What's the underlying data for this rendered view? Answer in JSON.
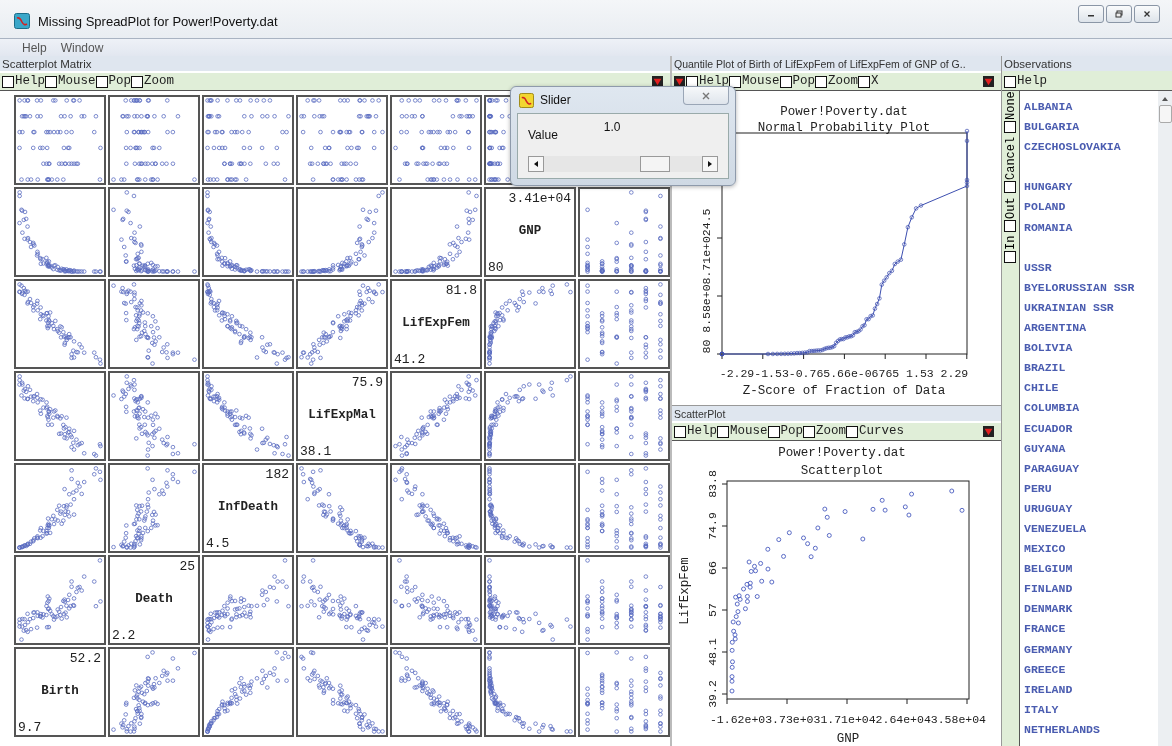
{
  "window": {
    "title": "Missing SpreadPlot for Power!Poverty.dat"
  },
  "menu": [
    "Help",
    "Window"
  ],
  "scatterplot_matrix": {
    "title": "Scatterplot Matrix",
    "toolbar": [
      {
        "label": "Help",
        "checked": false
      },
      {
        "label": "Mouse",
        "checked": false
      },
      {
        "label": "Pop",
        "checked": false
      },
      {
        "label": "Zoom",
        "checked": false
      }
    ],
    "variables": [
      {
        "name": "Birth",
        "max": "52.2",
        "min": "9.7"
      },
      {
        "name": "Death",
        "max": "25",
        "min": "2.2"
      },
      {
        "name": "InfDeath",
        "max": "182",
        "min": "4.5"
      },
      {
        "name": "LifExpMal",
        "max": "75.9",
        "min": "38.1"
      },
      {
        "name": "LifExpFem",
        "max": "81.8",
        "min": "41.2"
      },
      {
        "name": "GNP",
        "max": "3.41e+04",
        "min": "80"
      }
    ]
  },
  "quantile_plot": {
    "title": "Quantile Plot of Birth of LifExpFem of LifExpFem of GNP of G..",
    "toolbar": [
      {
        "label": "Help",
        "checked": false
      },
      {
        "label": "Mouse",
        "checked": false
      },
      {
        "label": "Pop",
        "checked": false
      },
      {
        "label": "Zoom",
        "checked": false
      },
      {
        "label": "X",
        "checked": false
      }
    ],
    "plot_title": "Power!Poverty.dat",
    "plot_subtitle": "Normal Probability Plot",
    "y_tick_labels": "80  8.58e+08.71e+024.5",
    "x_tick_labels": "-2.29-1.53-0.765.66e-06765 1.53 2.29",
    "xlabel": "Z-Score of Fraction of Data"
  },
  "scatterplot": {
    "title": "ScatterPlot",
    "toolbar": [
      {
        "label": "Help",
        "checked": false
      },
      {
        "label": "Mouse",
        "checked": false
      },
      {
        "label": "Pop",
        "checked": false
      },
      {
        "label": "Zoom",
        "checked": false
      },
      {
        "label": "Curves",
        "checked": false
      }
    ],
    "plot_title": "Power!Poverty.dat",
    "plot_subtitle": "Scatterplot",
    "ylabel": "LifExpFem",
    "yticks": [
      "39.2",
      "48.1",
      "57",
      "66",
      "74.9",
      "83.8"
    ],
    "x_tick_labels": "-1.62e+03.73e+031.71e+042.64e+043.58e+04",
    "xlabel": "GNP"
  },
  "observations": {
    "title": "Observations",
    "toolbar": [
      {
        "label": "Help",
        "checked": false
      }
    ],
    "side_controls": [
      {
        "label": "None",
        "checked": false
      },
      {
        "label": "Cancel",
        "checked": false
      },
      {
        "label": "Out",
        "checked": false
      },
      {
        "label": "In",
        "checked": false
      }
    ],
    "groups": [
      {
        "items": [
          {
            "label": "ALBANIA"
          },
          {
            "label": "BULGARIA"
          },
          {
            "label": "CZECHOSLOVAKIA"
          }
        ]
      },
      {
        "items": [
          {
            "label": "HUNGARY"
          },
          {
            "label": "POLAND"
          },
          {
            "label": "ROMANIA"
          }
        ]
      },
      {
        "items": [
          {
            "label": "USSR"
          },
          {
            "label": "BYELORUSSIAN SSR"
          },
          {
            "label": "UKRAINIAN SSR"
          },
          {
            "label": "ARGENTINA"
          },
          {
            "label": "BOLIVIA"
          },
          {
            "label": "BRAZIL"
          },
          {
            "label": "CHILE"
          },
          {
            "label": "COLUMBIA"
          },
          {
            "label": "ECUADOR"
          },
          {
            "label": "GUYANA"
          },
          {
            "label": "PARAGUAY"
          },
          {
            "label": "PERU"
          },
          {
            "label": "URUGUAY"
          },
          {
            "label": "VENEZUELA"
          },
          {
            "label": "MEXICO"
          },
          {
            "label": "BELGIUM"
          },
          {
            "label": "FINLAND"
          },
          {
            "label": "DENMARK"
          },
          {
            "label": "FRANCE"
          },
          {
            "label": "GERMANY"
          },
          {
            "label": "GREECE"
          },
          {
            "label": "IRELAND"
          },
          {
            "label": "ITALY"
          },
          {
            "label": "NETHERLANDS"
          }
        ]
      }
    ]
  },
  "slider": {
    "title": "Slider",
    "label": "Value",
    "value": "1.0",
    "level": 0.75
  }
}
